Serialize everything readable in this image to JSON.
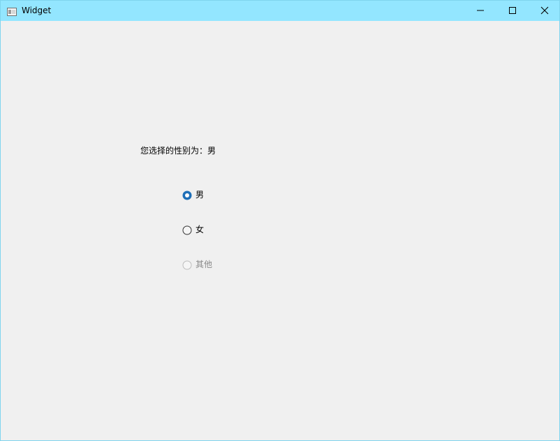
{
  "window": {
    "title": "Widget",
    "controls": {
      "minimize_icon": "minimize-icon",
      "maximize_icon": "maximize-icon",
      "close_icon": "close-icon"
    }
  },
  "main": {
    "status_text": "您选择的性别为：男",
    "gender_options": [
      {
        "label": "男",
        "checked": true,
        "enabled": true
      },
      {
        "label": "女",
        "checked": false,
        "enabled": true
      },
      {
        "label": "其他",
        "checked": false,
        "enabled": false
      }
    ]
  },
  "colors": {
    "titlebar": "#93e6ff",
    "window_bg": "#f0f0f0",
    "accent": "#1e6fb8"
  }
}
